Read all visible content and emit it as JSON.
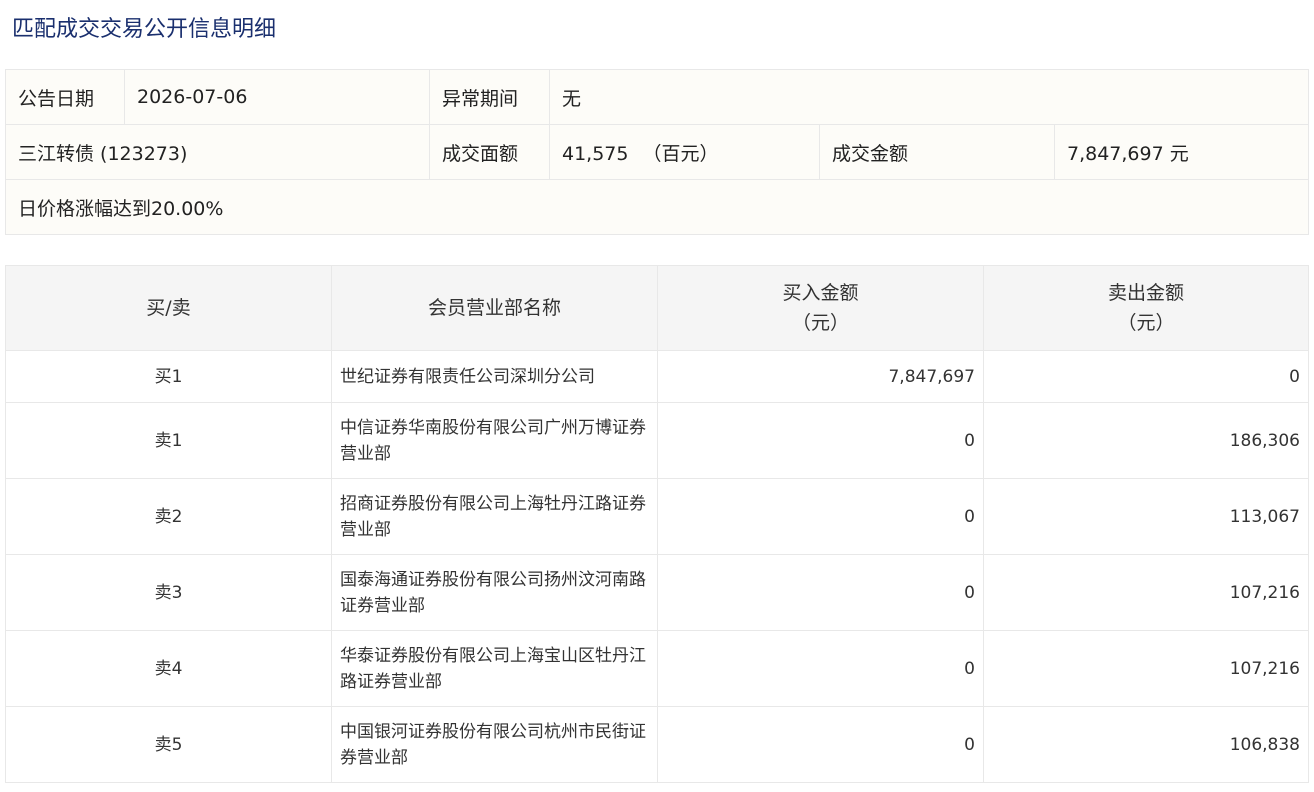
{
  "page": {
    "title": "匹配成交交易公开信息明细"
  },
  "info": {
    "announce_date_label": "公告日期",
    "announce_date_value": "2026-07-06",
    "abnormal_period_label": "异常期间",
    "abnormal_period_value": "无",
    "bond_name": "三江转债 (123273)",
    "face_value_label": "成交面额",
    "face_value_value": "41,575",
    "face_value_unit": "（百元）",
    "amount_label": "成交金额",
    "amount_value": "7,847,697 元",
    "reason": "日价格涨幅达到20.00%"
  },
  "trades": {
    "headers": {
      "side": "买/卖",
      "member": "会员营业部名称",
      "buy_amount": "买入金额",
      "buy_unit": "（元）",
      "sell_amount": "卖出金额",
      "sell_unit": "（元）"
    },
    "rows": [
      {
        "side": "买1",
        "member": "世纪证券有限责任公司深圳分公司",
        "buy": "7,847,697",
        "sell": "0"
      },
      {
        "side": "卖1",
        "member": "中信证券华南股份有限公司广州万博证券营业部",
        "buy": "0",
        "sell": "186,306"
      },
      {
        "side": "卖2",
        "member": "招商证券股份有限公司上海牡丹江路证券营业部",
        "buy": "0",
        "sell": "113,067"
      },
      {
        "side": "卖3",
        "member": "国泰海通证券股份有限公司扬州汶河南路证券营业部",
        "buy": "0",
        "sell": "107,216"
      },
      {
        "side": "卖4",
        "member": "华泰证券股份有限公司上海宝山区牡丹江路证券营业部",
        "buy": "0",
        "sell": "107,216"
      },
      {
        "side": "卖5",
        "member": "中国银河证券股份有限公司杭州市民街证券营业部",
        "buy": "0",
        "sell": "106,838"
      }
    ]
  }
}
